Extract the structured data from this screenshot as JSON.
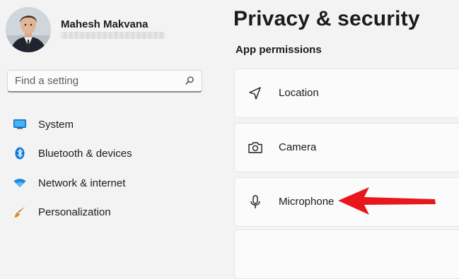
{
  "user": {
    "name": "Mahesh Makvana"
  },
  "search": {
    "placeholder": "Find a setting"
  },
  "sidebar": {
    "items": [
      {
        "label": "System",
        "icon": "monitor-icon"
      },
      {
        "label": "Bluetooth & devices",
        "icon": "bluetooth-icon"
      },
      {
        "label": "Network & internet",
        "icon": "wifi-icon"
      },
      {
        "label": "Personalization",
        "icon": "paintbrush-icon"
      }
    ]
  },
  "main": {
    "title": "Privacy & security",
    "section_title": "App permissions",
    "cards": [
      {
        "label": "Location",
        "icon": "location-icon"
      },
      {
        "label": "Camera",
        "icon": "camera-icon"
      },
      {
        "label": "Microphone",
        "icon": "microphone-icon"
      }
    ]
  },
  "annotation": {
    "arrow_color": "#e8171d",
    "points_to": "Microphone"
  },
  "colors": {
    "accent": "#0067c0",
    "background": "#f3f3f3",
    "card": "#fbfbfb"
  }
}
